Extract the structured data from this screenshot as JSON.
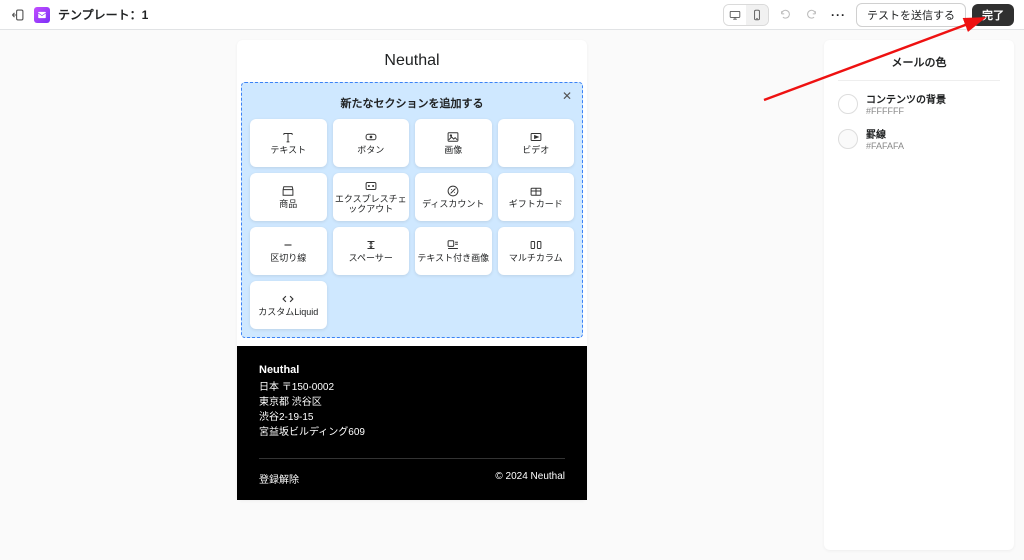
{
  "topbar": {
    "title": "テンプレート：1",
    "test_label": "テストを送信する",
    "done_label": "完了"
  },
  "email": {
    "brand": "Neuthal",
    "picker_title": "新たなセクションを追加する",
    "tiles": [
      {
        "label": "テキスト"
      },
      {
        "label": "ボタン"
      },
      {
        "label": "画像"
      },
      {
        "label": "ビデオ"
      },
      {
        "label": "商品"
      },
      {
        "label": "エクスプレスチェックアウト"
      },
      {
        "label": "ディスカウント"
      },
      {
        "label": "ギフトカード"
      },
      {
        "label": "区切り線"
      },
      {
        "label": "スペーサー"
      },
      {
        "label": "テキスト付き画像"
      },
      {
        "label": "マルチカラム"
      },
      {
        "label": "カスタムLiquid"
      }
    ],
    "footer": {
      "name": "Neuthal",
      "line1": "日本 〒150-0002",
      "line2": "東京都 渋谷区",
      "line3": "渋谷2-19-15",
      "line4": "宮益坂ビルディング609",
      "unsubscribe": "登録解除",
      "copyright": "© 2024 Neuthal"
    }
  },
  "sidebar": {
    "title": "メールの色",
    "rows": [
      {
        "label": "コンテンツの背景",
        "value": "#FFFFFF"
      },
      {
        "label": "罫線",
        "value": "#FAFAFA"
      }
    ]
  }
}
